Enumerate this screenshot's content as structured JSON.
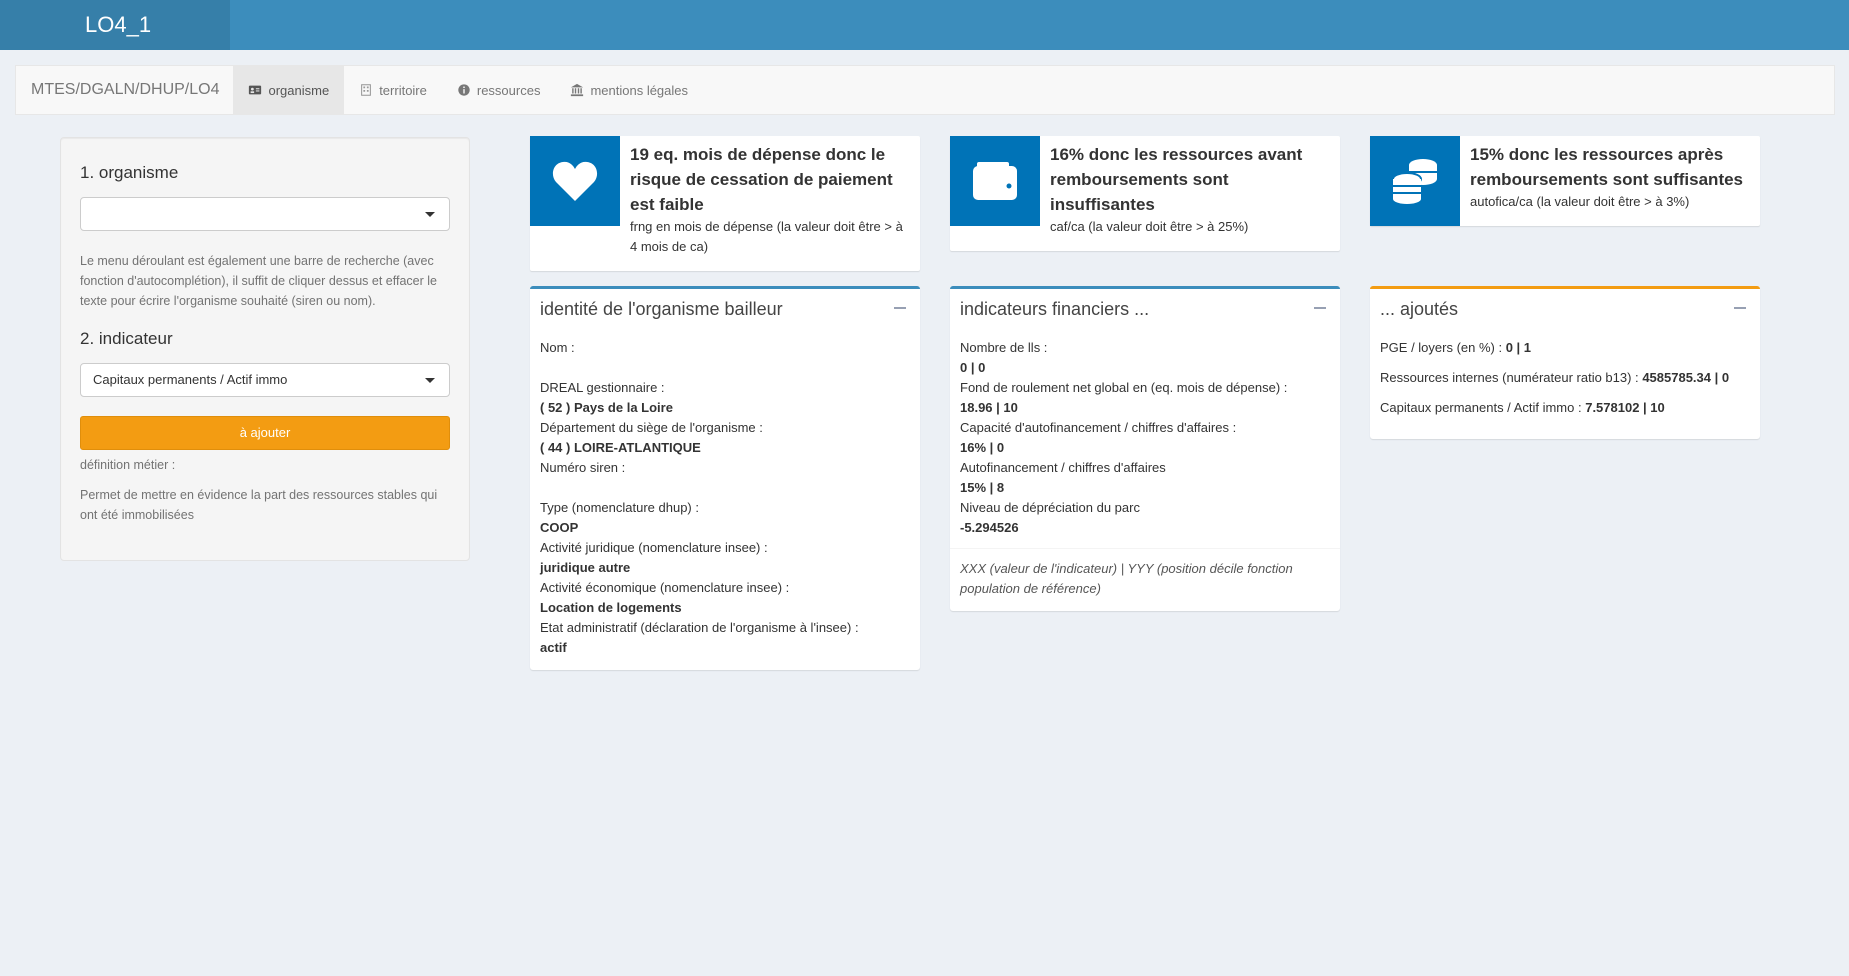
{
  "app": {
    "title": "LO4_1"
  },
  "navbar": {
    "brand": "MTES/DGALN/DHUP/LO4",
    "tabs": [
      {
        "label": "organisme",
        "icon": "id-card-icon",
        "active": true
      },
      {
        "label": "territoire",
        "icon": "building-icon",
        "active": false
      },
      {
        "label": "ressources",
        "icon": "info-circle-icon",
        "active": false
      },
      {
        "label": "mentions légales",
        "icon": "bank-icon",
        "active": false
      }
    ]
  },
  "sidebar": {
    "organisme_label": "1. organisme",
    "organisme_value": "",
    "organisme_help": "Le menu déroulant est également une barre de recherche (avec fonction d'autocomplétion), il suffit de cliquer dessus et effacer le texte pour écrire l'organisme souhaité (siren ou nom).",
    "indicateur_label": "2. indicateur",
    "indicateur_value": "Capitaux permanents / Actif immo",
    "add_button": "à ajouter",
    "definition_label": "définition métier :",
    "definition_text": "Permet de mettre en évidence la part des ressources stables qui ont été immobilisées"
  },
  "infoboxes": [
    {
      "icon": "heart-icon",
      "number": "19 eq. mois de dépense donc le risque de cessation de paiement est faible",
      "sub": "frng en mois de dépense (la valeur doit être > à 4 mois de ca)",
      "color": "#0073b7"
    },
    {
      "icon": "wallet-icon",
      "number": "16% donc les ressources avant remboursements sont insuffisantes",
      "sub": "caf/ca (la valeur doit être > à 25%)",
      "color": "#0073b7"
    },
    {
      "icon": "coins-icon",
      "number": "15% donc les ressources après remboursements sont suffisantes",
      "sub": "autofica/ca (la valeur doit être > à 3%)",
      "color": "#0073b7"
    }
  ],
  "identite": {
    "title": "identité de l'organisme bailleur",
    "nom_label": "Nom :",
    "nom_value": "",
    "dreal_label": "DREAL gestionnaire :",
    "dreal_value": "( 52 ) Pays de la Loire",
    "dept_label": "Département du siège de l'organisme :",
    "dept_value": "( 44 ) LOIRE-ATLANTIQUE",
    "siren_label": "Numéro siren :",
    "siren_value": "",
    "type_label": "Type (nomenclature dhup) :",
    "type_value": "COOP",
    "actjur_label": "Activité juridique (nomenclature insee) :",
    "actjur_value": "juridique autre",
    "acteco_label": "Activité économique (nomenclature insee) :",
    "acteco_value": "Location de logements",
    "etat_label": "Etat administratif (déclaration de l'organisme à l'insee) :",
    "etat_value": "actif"
  },
  "financiers": {
    "title": "indicateurs financiers ...",
    "rows": [
      {
        "label": "Nombre de lls :",
        "value": "0 | 0"
      },
      {
        "label": "Fond de roulement net global en (eq. mois de dépense) :",
        "value": "18.96 | 10"
      },
      {
        "label": "Capacité d'autofinancement / chiffres d'affaires :",
        "value": "16% | 0"
      },
      {
        "label": "Autofinancement / chiffres d'affaires",
        "value": "15% | 8"
      },
      {
        "label": "Niveau de dépréciation du parc",
        "value": "-5.294526"
      }
    ],
    "footer": "XXX (valeur de l'indicateur) | YYY (position décile fonction population de référence)"
  },
  "ajoutes": {
    "title": "... ajoutés",
    "rows": [
      {
        "label": "PGE / loyers (en %) :",
        "value": "0 | 1"
      },
      {
        "label": "Ressources internes (numérateur ratio b13) :",
        "value": "4585785.34 | 0"
      },
      {
        "label": "Capitaux permanents / Actif immo :",
        "value": "7.578102 | 10"
      }
    ]
  }
}
